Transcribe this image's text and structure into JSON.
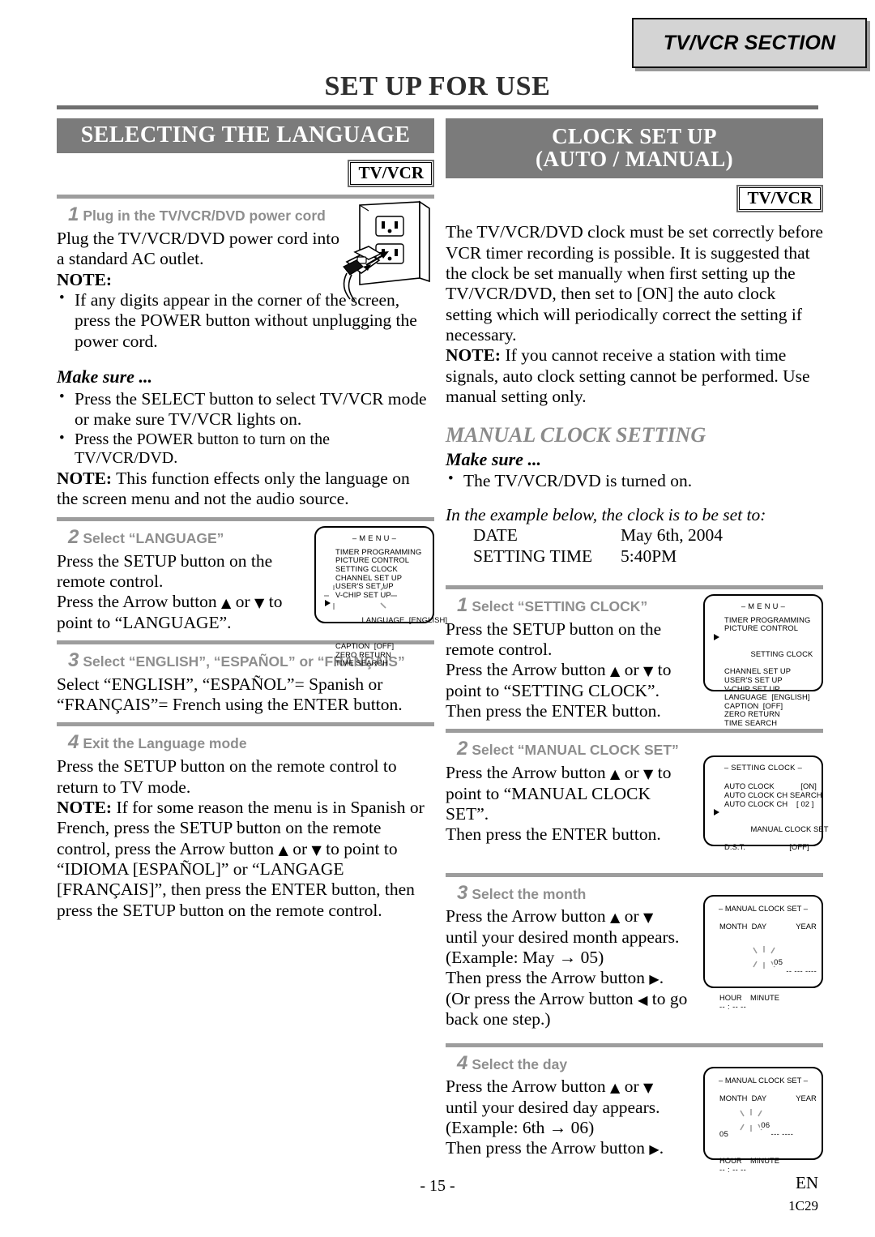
{
  "section_tab": "TV/VCR SECTION",
  "page_title": "SET UP FOR USE",
  "badge_label": "TV/VCR",
  "left": {
    "bar_title": "SELECTING THE LANGUAGE",
    "step1": {
      "number": "1",
      "heading": "Plug in the TV/VCR/DVD power cord",
      "body": "Plug the TV/VCR/DVD power cord into a standard AC outlet.",
      "note_label": "NOTE:",
      "note_bullet": "If any digits appear in the corner of the screen, press the POWER button without unplugging the power cord.",
      "illustration": "ac-outlet-plug"
    },
    "make_sure_label": "Make sure ...",
    "make_sure_bullets": [
      "Press the SELECT button to select TV/VCR mode or make sure TV/VCR lights on.",
      "Press the POWER button to turn on the TV/VCR/DVD."
    ],
    "note2_label": "NOTE:",
    "note2_text": "This function effects only the language on the screen menu and not the audio source.",
    "step2": {
      "number": "2",
      "heading": "Select “LANGUAGE”",
      "body1": "Press the SETUP button on the remote control.",
      "body2_a": "Press the Arrow button ",
      "body2_b": " or ",
      "body2_c": " to point to “LANGUAGE”."
    },
    "step3": {
      "number": "3",
      "heading": "Select “ENGLISH”, “ESPAÑOL” or “FRANÇAIS”",
      "body": "Select “ENGLISH”, “ESPAÑOL”= Spanish or “FRANÇAIS”= French using the ENTER button."
    },
    "step4": {
      "number": "4",
      "heading": "Exit the Language mode",
      "body": "Press the SETUP button on the remote control to return to TV mode.",
      "note_label": "NOTE:",
      "note_a": "If for some reason the menu is in Spanish or French, press the SETUP button on the remote control, press the Arrow button ",
      "note_b": " or ",
      "note_c": " to point to “IDIOMA [ESPAÑOL]” or “LANGAGE [FRANÇAIS]”, then press the ENTER button, then press the SETUP button on the remote control."
    },
    "menu_screen": {
      "title": "– M E N U –",
      "items": [
        "TIMER PROGRAMMING",
        "PICTURE CONTROL",
        "SETTING CLOCK",
        "CHANNEL SET UP",
        "USER'S SET UP",
        "V-CHIP SET UP",
        "LANGUAGE  [ENGLISH]",
        "CAPTION  [OFF]",
        "ZERO RETURN",
        "TIME SEARCH"
      ],
      "cursor_index": 6,
      "blink_index": 6
    }
  },
  "right": {
    "bar_title_line1": "CLOCK SET UP",
    "bar_title_line2": "(AUTO / MANUAL)",
    "intro": "The TV/VCR/DVD clock must be set correctly before VCR timer recording is possible. It is suggested that the clock be set manually when first setting up the TV/VCR/DVD, then set to [ON] the auto clock setting which will periodically correct the setting if necessary.",
    "note_label": "NOTE:",
    "note_text": "If you cannot receive a station with time signals, auto clock setting cannot be performed. Use manual setting only.",
    "subtitle": "MANUAL CLOCK SETTING",
    "make_sure_label": "Make sure ...",
    "make_sure_bullets": [
      "The TV/VCR/DVD is turned on."
    ],
    "example_intro": "In the example below, the clock is to be set to:",
    "example_rows": [
      {
        "label": "DATE",
        "value": "May 6th, 2004"
      },
      {
        "label": "SETTING TIME",
        "value": "5:40PM"
      }
    ],
    "step1": {
      "number": "1",
      "heading": "Select “SETTING CLOCK”",
      "body1": "Press the SETUP button on the remote control.",
      "body2_a": "Press the Arrow button ",
      "body2_b": " or ",
      "body2_c": " to point to “SETTING CLOCK”.",
      "body3": "Then press the ENTER button."
    },
    "step2": {
      "number": "2",
      "heading": "Select “MANUAL CLOCK SET”",
      "body1_a": "Press the Arrow button ",
      "body1_b": " or ",
      "body1_c": " to point to “MANUAL CLOCK SET”.",
      "body2": "Then press the ENTER button."
    },
    "step3": {
      "number": "3",
      "heading": "Select the month",
      "body1_a": "Press the Arrow button ",
      "body1_b": " or ",
      "body1_c": " until your desired month appears.",
      "body2": "(Example: May → 05)",
      "body3_a": "Then press the Arrow button ",
      "body3_b": ".",
      "body4_a": "(Or press the Arrow button ",
      "body4_b": " to go back one step.)"
    },
    "step4": {
      "number": "4",
      "heading": "Select the day",
      "body1_a": "Press the Arrow button ",
      "body1_b": " or ",
      "body1_c": " until your desired day appears.",
      "body2": "(Example: 6th → 06)",
      "body3_a": "Then press the Arrow button ",
      "body3_b": "."
    },
    "menu_screen": {
      "title": "– M E N U –",
      "items": [
        "TIMER PROGRAMMING",
        "PICTURE CONTROL",
        "SETTING CLOCK",
        "CHANNEL SET UP",
        "USER'S SET UP",
        "V-CHIP SET UP",
        "LANGUAGE  [ENGLISH]",
        "CAPTION  [OFF]",
        "ZERO RETURN",
        "TIME SEARCH"
      ],
      "cursor_index": 2
    },
    "setting_clock_screen": {
      "title": "– SETTING CLOCK –",
      "items": [
        "AUTO CLOCK            [ON]",
        "AUTO CLOCK CH SEARCH",
        "AUTO CLOCK CH    [ 02 ]",
        "MANUAL CLOCK SET",
        "D.S.T.                    [OFF]"
      ],
      "cursor_index": 3
    },
    "manual_clock_screen_month": {
      "title": "– MANUAL CLOCK SET –",
      "row1_labels": "MONTH  DAY              YEAR",
      "month": "05",
      "day": "--",
      "year_a": "---",
      "year_b": "----",
      "row2_labels": "HOUR    MINUTE",
      "hour": "--",
      "minute": "--",
      "ampm": "--",
      "blink_field": "month"
    },
    "manual_clock_screen_day": {
      "title": "– MANUAL CLOCK SET –",
      "row1_labels": "MONTH  DAY              YEAR",
      "month": "05",
      "day": "06",
      "year_a": "---",
      "year_b": "----",
      "row2_labels": "HOUR    MINUTE",
      "hour": "--",
      "minute": "--",
      "ampm": "--",
      "blink_field": "day"
    }
  },
  "footer": {
    "page_number": "- 15 -",
    "lang_code": "EN",
    "doc_code": "1C29"
  },
  "glyphs": {
    "up": "▲",
    "down": "▼",
    "right": "▶",
    "left": "◀"
  }
}
